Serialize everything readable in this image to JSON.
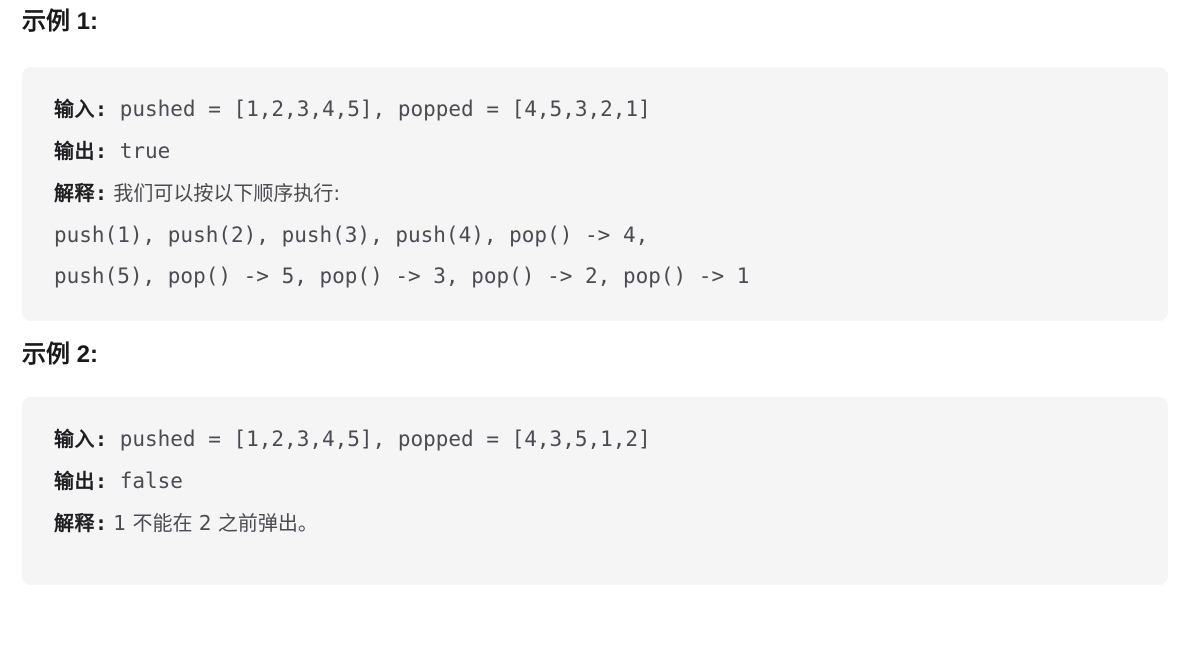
{
  "examples": [
    {
      "heading": "示例 1:",
      "rows": [
        {
          "label": "输入",
          "colon": ":",
          "value": " pushed = [1,2,3,4,5], popped = [4,5,3,2,1]",
          "value_type": "mono"
        },
        {
          "label": "输出",
          "colon": ":",
          "value": " true",
          "value_type": "mono"
        },
        {
          "label": "解释",
          "colon": ":",
          "value": " 我们可以按以下顺序执行:",
          "value_type": "cjk"
        }
      ],
      "continuation_lines": [
        "push(1), push(2), push(3), push(4), pop() -> 4,",
        "push(5), pop() -> 5, pop() -> 3, pop() -> 2, pop() -> 1"
      ]
    },
    {
      "heading": "示例 2:",
      "rows": [
        {
          "label": "输入",
          "colon": ":",
          "value": " pushed = [1,2,3,4,5], popped = [4,3,5,1,2]",
          "value_type": "mono"
        },
        {
          "label": "输出",
          "colon": ":",
          "value": " false",
          "value_type": "mono"
        },
        {
          "label": "解释",
          "colon": ":",
          "value": " 1 不能在 2 之前弹出。",
          "value_type": "cjk"
        }
      ],
      "continuation_lines": []
    }
  ],
  "colors": {
    "page_background": "#ffffff",
    "code_block_background": "#f5f5f5",
    "heading_text": "#191919",
    "label_text": "#1f1f23",
    "value_text": "#4b4b53"
  }
}
